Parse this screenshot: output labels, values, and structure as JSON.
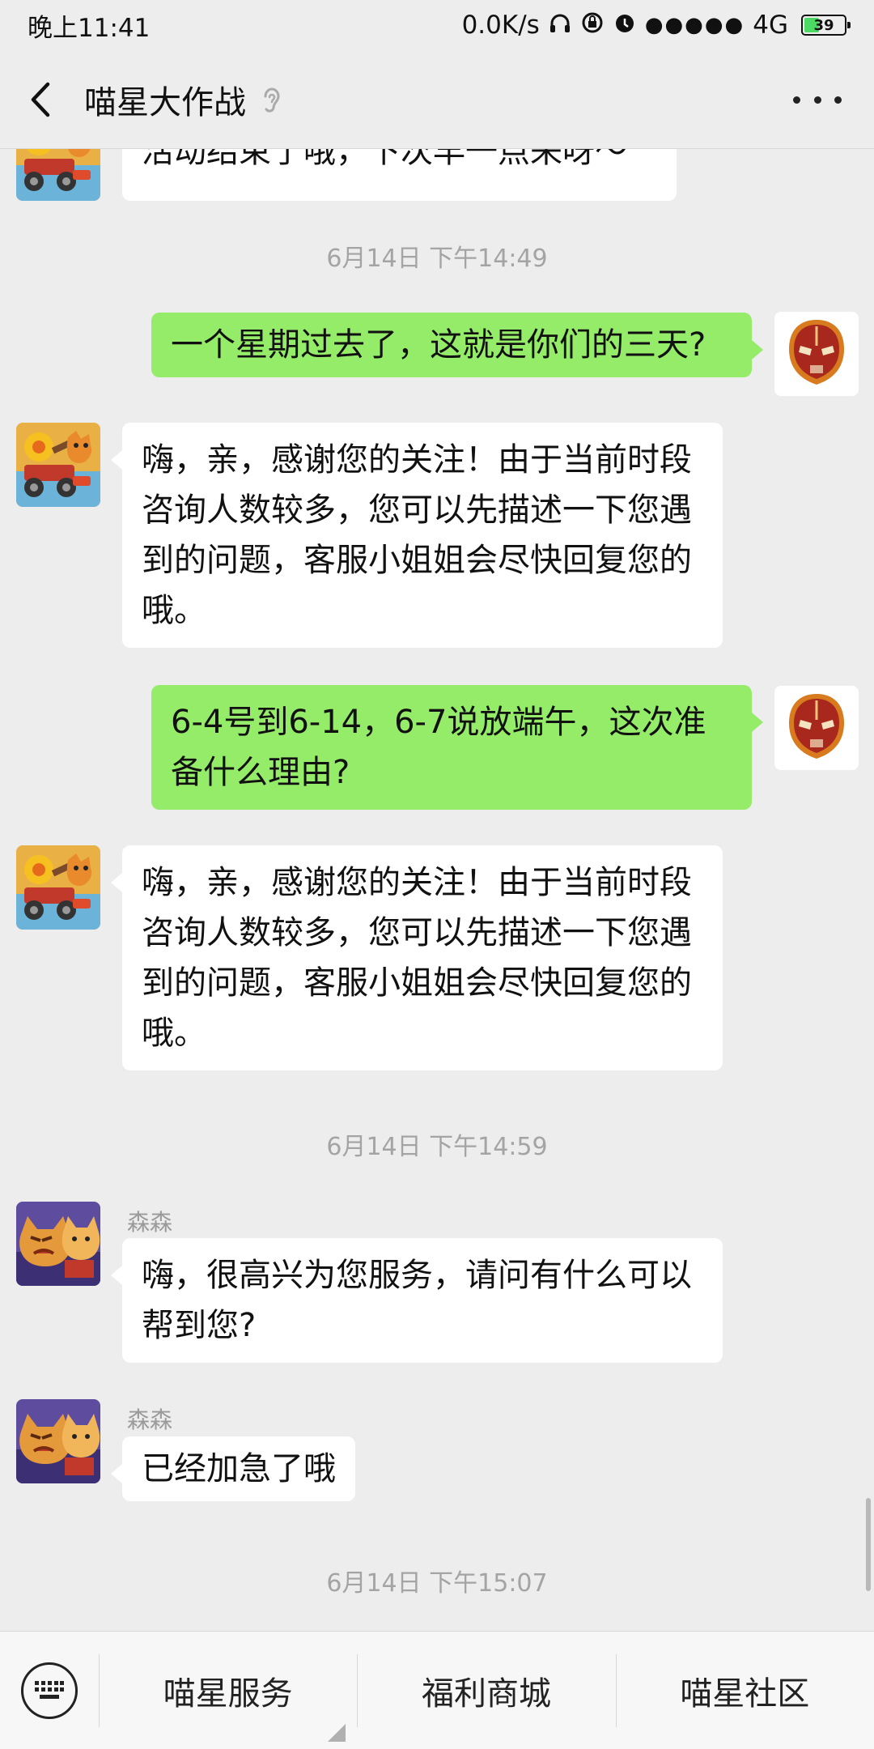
{
  "status_bar": {
    "time": "晚上11:41",
    "speed": "0.0K/s",
    "signal": "●●●●●",
    "network": "4G",
    "battery": "39",
    "battery_level": 0.39
  },
  "header": {
    "title": "喵星大作战"
  },
  "messages": {
    "m0": {
      "text": "活动结束了哦，下次早一点来呀～"
    },
    "t1": "6月14日 下午14:49",
    "m1": {
      "text": "一个星期过去了，这就是你们的三天?"
    },
    "m2": {
      "text": "嗨，亲，感谢您的关注！由于当前时段咨询人数较多，您可以先描述一下您遇到的问题，客服小姐姐会尽快回复您的哦。"
    },
    "m3": {
      "text": "6-4号到6-14，6-7说放端午，这次准备什么理由?"
    },
    "m4": {
      "text": "嗨，亲，感谢您的关注！由于当前时段咨询人数较多，您可以先描述一下您遇到的问题，客服小姐姐会尽快回复您的哦。"
    },
    "t2": "6月14日 下午14:59",
    "m5": {
      "sender": "森森",
      "text": "嗨，很高兴为您服务，请问有什么可以帮到您?"
    },
    "m6": {
      "sender": "森森",
      "text": "已经加急了哦"
    },
    "t3": "6月14日 下午15:07"
  },
  "bottom_menu": {
    "items": [
      "喵星服务",
      "福利商城",
      "喵星社区"
    ]
  },
  "colors": {
    "background": "#ededed",
    "outgoing_bubble": "#95ec69",
    "incoming_bubble": "#ffffff"
  }
}
